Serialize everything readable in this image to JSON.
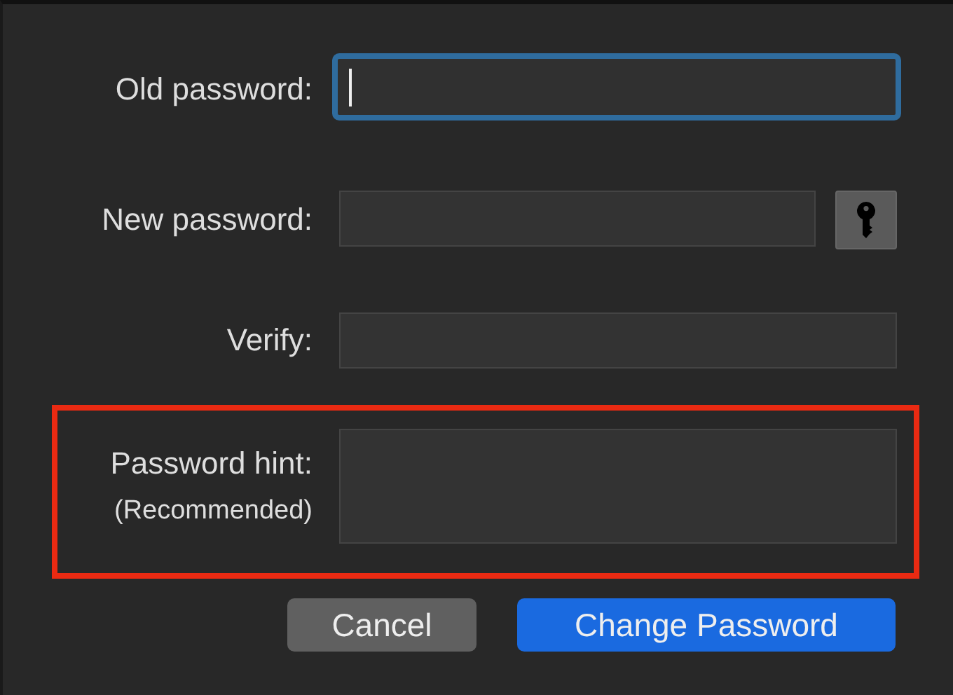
{
  "fields": [
    {
      "kind": "single",
      "label": "Old password:",
      "focused": true,
      "highlighted": false,
      "key_button": false
    },
    {
      "kind": "single",
      "label": "New password:",
      "focused": false,
      "highlighted": false,
      "key_button": true
    },
    {
      "kind": "single",
      "label": "Verify:",
      "focused": false,
      "highlighted": false,
      "key_button": false
    },
    {
      "kind": "multiline",
      "label": "Password hint:",
      "sublabel": "(Recommended)",
      "focused": false,
      "highlighted": true,
      "key_button": false
    }
  ],
  "buttons": [
    {
      "label": "Cancel",
      "kind": "secondary"
    },
    {
      "label": "Change Password",
      "kind": "primary"
    }
  ]
}
